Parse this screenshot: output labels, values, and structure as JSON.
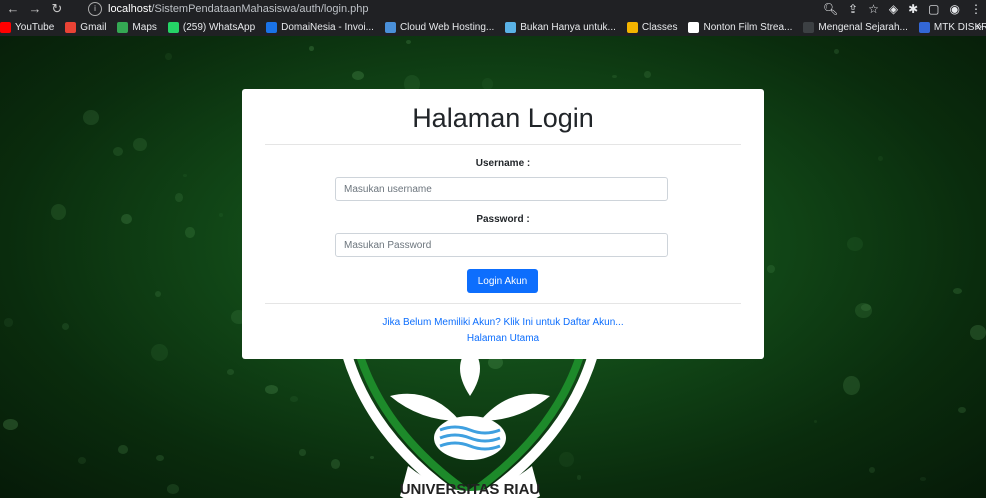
{
  "browser": {
    "url_host": "localhost",
    "url_path": "/SistemPendataanMahasiswa/auth/login.php",
    "bookmarks": [
      {
        "label": "YouTube",
        "color": "#ff0000",
        "icon": "youtube-icon"
      },
      {
        "label": "Gmail",
        "color": "#ea4335",
        "icon": "gmail-icon"
      },
      {
        "label": "Maps",
        "color": "#34a853",
        "icon": "maps-icon"
      },
      {
        "label": "(259) WhatsApp",
        "color": "#25d366",
        "icon": "whatsapp-icon"
      },
      {
        "label": "DomaiNesia - Invoi...",
        "color": "#1a73e8",
        "icon": "domainesia-icon"
      },
      {
        "label": "Cloud Web Hosting...",
        "color": "#4a90d9",
        "icon": "hosting-icon"
      },
      {
        "label": "Bukan Hanya untuk...",
        "color": "#5ab2e6",
        "icon": "diamond-icon"
      },
      {
        "label": "Classes",
        "color": "#f4b400",
        "icon": "classes-icon"
      },
      {
        "label": "Nonton Film Strea...",
        "color": "#ffffff",
        "icon": "film-icon"
      },
      {
        "label": "Mengenal Sejarah...",
        "color": "#3c4043",
        "icon": "page-icon"
      },
      {
        "label": "MTK DISKRIT | Prezi",
        "color": "#3367d6",
        "icon": "prezi-icon"
      }
    ],
    "more": "»"
  },
  "login": {
    "title": "Halaman Login",
    "username_label": "Username :",
    "username_placeholder": "Masukan username",
    "password_label": "Password :",
    "password_placeholder": "Masukan Password",
    "submit_label": "Login Akun",
    "register_link": "Jika Belum Memiliki Akun? Klik Ini untuk Daftar Akun...",
    "home_link": "Halaman Utama"
  },
  "emblem": {
    "text": "UNIVERSITAS RIAU"
  },
  "colors": {
    "primary": "#0d6efd",
    "background_green": "#1f6a26"
  }
}
